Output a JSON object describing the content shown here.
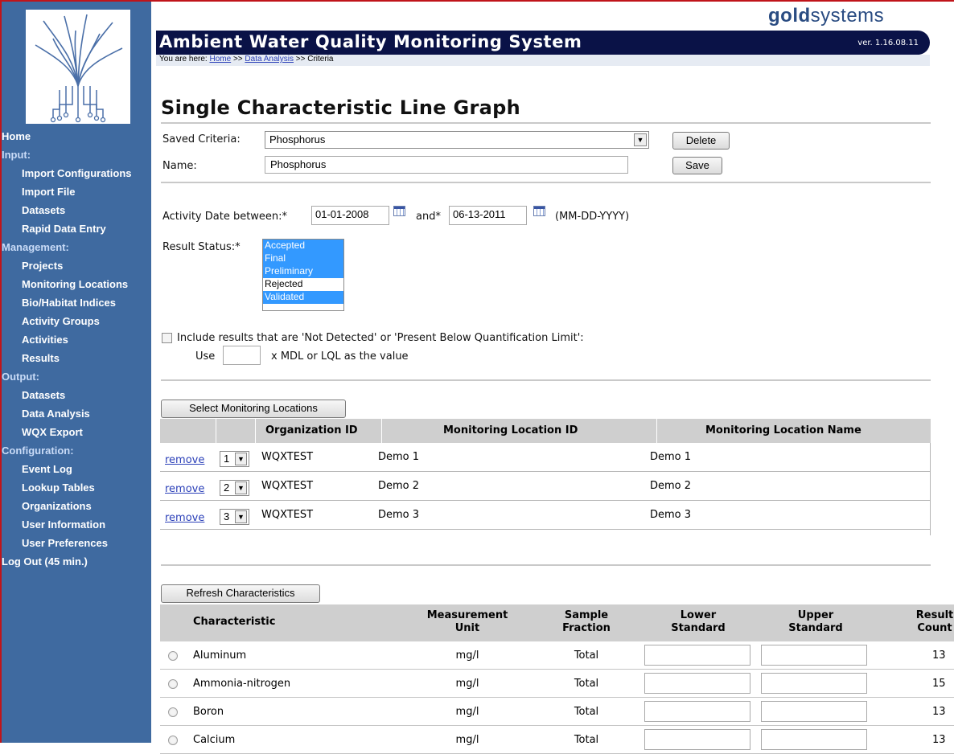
{
  "brand": {
    "gold": "gold",
    "systems": "systems"
  },
  "app": {
    "title": "Ambient Water Quality Monitoring System",
    "version": "ver. 1.16.08.11"
  },
  "breadcrumb": {
    "prefix": "You are here:",
    "home": "Home",
    "sep": ">>",
    "analysis": "Data Analysis",
    "current": "Criteria"
  },
  "sidebar": {
    "items": [
      {
        "label": "Home",
        "kind": "top"
      },
      {
        "label": "Input:",
        "kind": "section"
      },
      {
        "label": "Import Configurations",
        "kind": "sub"
      },
      {
        "label": "Import File",
        "kind": "sub"
      },
      {
        "label": "Datasets",
        "kind": "sub"
      },
      {
        "label": "Rapid Data Entry",
        "kind": "sub"
      },
      {
        "label": "Management:",
        "kind": "section"
      },
      {
        "label": "Projects",
        "kind": "sub"
      },
      {
        "label": "Monitoring Locations",
        "kind": "sub"
      },
      {
        "label": "Bio/Habitat Indices",
        "kind": "sub"
      },
      {
        "label": "Activity Groups",
        "kind": "sub"
      },
      {
        "label": "Activities",
        "kind": "sub"
      },
      {
        "label": "Results",
        "kind": "sub"
      },
      {
        "label": "Output:",
        "kind": "section"
      },
      {
        "label": "Datasets",
        "kind": "sub"
      },
      {
        "label": "Data Analysis",
        "kind": "sub"
      },
      {
        "label": "WQX Export",
        "kind": "sub"
      },
      {
        "label": "Configuration:",
        "kind": "section"
      },
      {
        "label": "Event Log",
        "kind": "sub"
      },
      {
        "label": "Lookup Tables",
        "kind": "sub"
      },
      {
        "label": "Organizations",
        "kind": "sub"
      },
      {
        "label": "User Information",
        "kind": "sub"
      },
      {
        "label": "User Preferences",
        "kind": "sub"
      },
      {
        "label": "Log Out (45 min.)",
        "kind": "top"
      }
    ]
  },
  "page": {
    "title": "Single Characteristic Line Graph"
  },
  "criteria": {
    "saved_label": "Saved Criteria:",
    "saved_value": "Phosphorus",
    "delete_label": "Delete",
    "name_label": "Name:",
    "name_value": "Phosphorus",
    "save_label": "Save"
  },
  "dates": {
    "between_label": "Activity Date between:*",
    "start": "01-01-2008",
    "and_label": "and*",
    "end": "06-13-2011",
    "format_hint": "(MM-DD-YYYY)"
  },
  "status": {
    "label": "Result Status:*",
    "options": [
      {
        "label": "Accepted",
        "selected": true
      },
      {
        "label": "Final",
        "selected": true
      },
      {
        "label": "Preliminary",
        "selected": true
      },
      {
        "label": "Rejected",
        "selected": false
      },
      {
        "label": "Validated",
        "selected": true
      }
    ]
  },
  "detect": {
    "include_label": "Include results that are 'Not Detected' or 'Present Below Quantification Limit':",
    "use_label": "Use",
    "factor_value": "",
    "suffix": "x MDL or LQL as the value"
  },
  "locations": {
    "select_button": "Select Monitoring Locations",
    "headers": [
      "Organization ID",
      "Monitoring Location ID",
      "Monitoring Location Name"
    ],
    "remove_label": "remove",
    "rows": [
      {
        "order": "1",
        "org": "WQXTEST",
        "loc_id": "Demo 1",
        "name": "Demo 1"
      },
      {
        "order": "2",
        "org": "WQXTEST",
        "loc_id": "Demo 2",
        "name": "Demo 2"
      },
      {
        "order": "3",
        "org": "WQXTEST",
        "loc_id": "Demo 3",
        "name": "Demo 3"
      }
    ]
  },
  "characteristics": {
    "refresh_button": "Refresh Characteristics",
    "headers": {
      "characteristic": "Characteristic",
      "unit_1": "Measurement",
      "unit_2": "Unit",
      "fraction_1": "Sample",
      "fraction_2": "Fraction",
      "lower_1": "Lower",
      "lower_2": "Standard",
      "upper_1": "Upper",
      "upper_2": "Standard",
      "count_1": "Result",
      "count_2": "Count"
    },
    "rows": [
      {
        "name": "Aluminum",
        "unit": "mg/l",
        "fraction": "Total",
        "count": "13"
      },
      {
        "name": "Ammonia-nitrogen",
        "unit": "mg/l",
        "fraction": "Total",
        "count": "15"
      },
      {
        "name": "Boron",
        "unit": "mg/l",
        "fraction": "Total",
        "count": "13"
      },
      {
        "name": "Calcium",
        "unit": "mg/l",
        "fraction": "Total",
        "count": "13"
      }
    ]
  }
}
